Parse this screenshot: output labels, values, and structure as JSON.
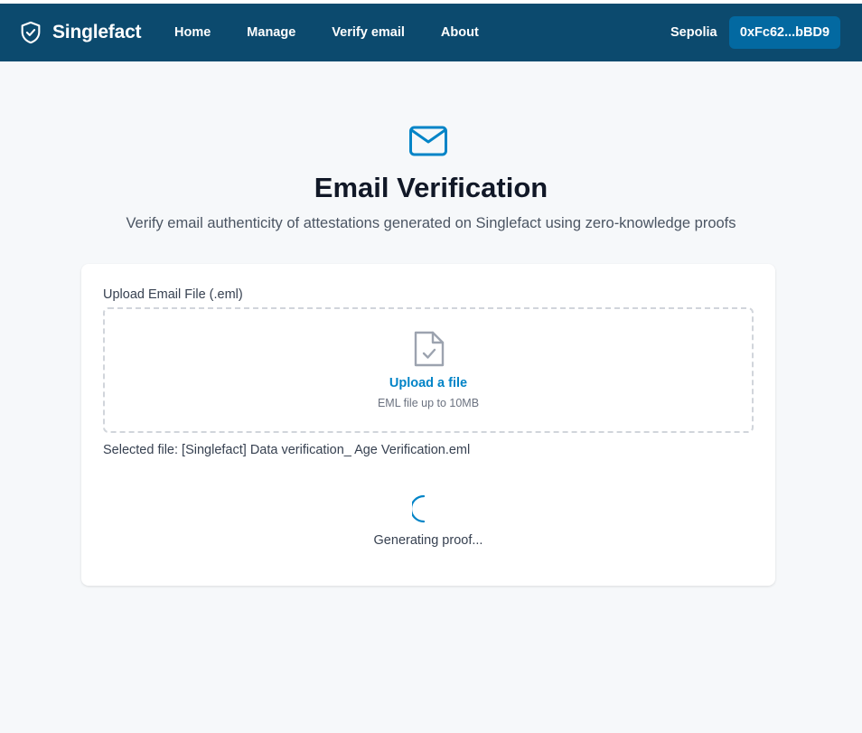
{
  "navbar": {
    "brand": "Singlefact",
    "brand_icon": "shield-check-icon",
    "links": [
      "Home",
      "Manage",
      "Verify email",
      "About"
    ],
    "network": "Sepolia",
    "wallet": "0xFc62...bBD9",
    "background_color": "#0c4a6e",
    "wallet_button_color": "#0369a1"
  },
  "header": {
    "icon": "mail-icon",
    "title": "Email Verification",
    "subtitle": "Verify email authenticity of attestations generated on Singlefact using zero-knowledge proofs",
    "accent_color": "#0284c7"
  },
  "upload": {
    "label": "Upload Email File (.eml)",
    "icon": "file-check-icon",
    "link": "Upload a file",
    "hint": "EML file up to 10MB",
    "selected_file": "Selected file: [Singlefact] Data verification_ Age Verification.eml"
  },
  "status": {
    "icon": "spinner-icon",
    "text": "Generating proof..."
  }
}
